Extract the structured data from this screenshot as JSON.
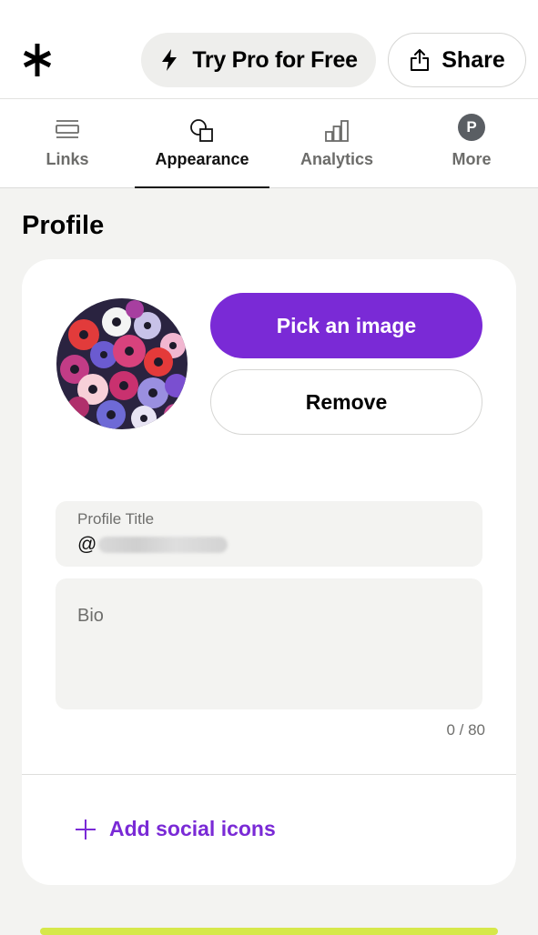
{
  "header": {
    "logo_icon": "asterisk-logo-icon",
    "pro_button_label": "Try Pro for Free",
    "pro_button_icon": "lightning-icon",
    "share_button_label": "Share",
    "share_button_icon": "share-upload-icon"
  },
  "tabs": [
    {
      "label": "Links",
      "icon": "links-icon",
      "active": false
    },
    {
      "label": "Appearance",
      "icon": "shapes-icon",
      "active": true
    },
    {
      "label": "Analytics",
      "icon": "bar-chart-icon",
      "active": false
    },
    {
      "label": "More",
      "icon": "avatar",
      "avatar_letter": "P",
      "active": false
    }
  ],
  "profile": {
    "section_title": "Profile",
    "pick_image_label": "Pick an image",
    "remove_label": "Remove",
    "title_field": {
      "label": "Profile Title",
      "value_prefix": "@"
    },
    "bio_field": {
      "placeholder": "Bio",
      "counter": "0 / 80"
    },
    "add_social_label": "Add social icons"
  },
  "colors": {
    "accent_purple": "#7a2ad6",
    "background": "#f3f3f1",
    "lime_strip": "#d6e84a"
  }
}
